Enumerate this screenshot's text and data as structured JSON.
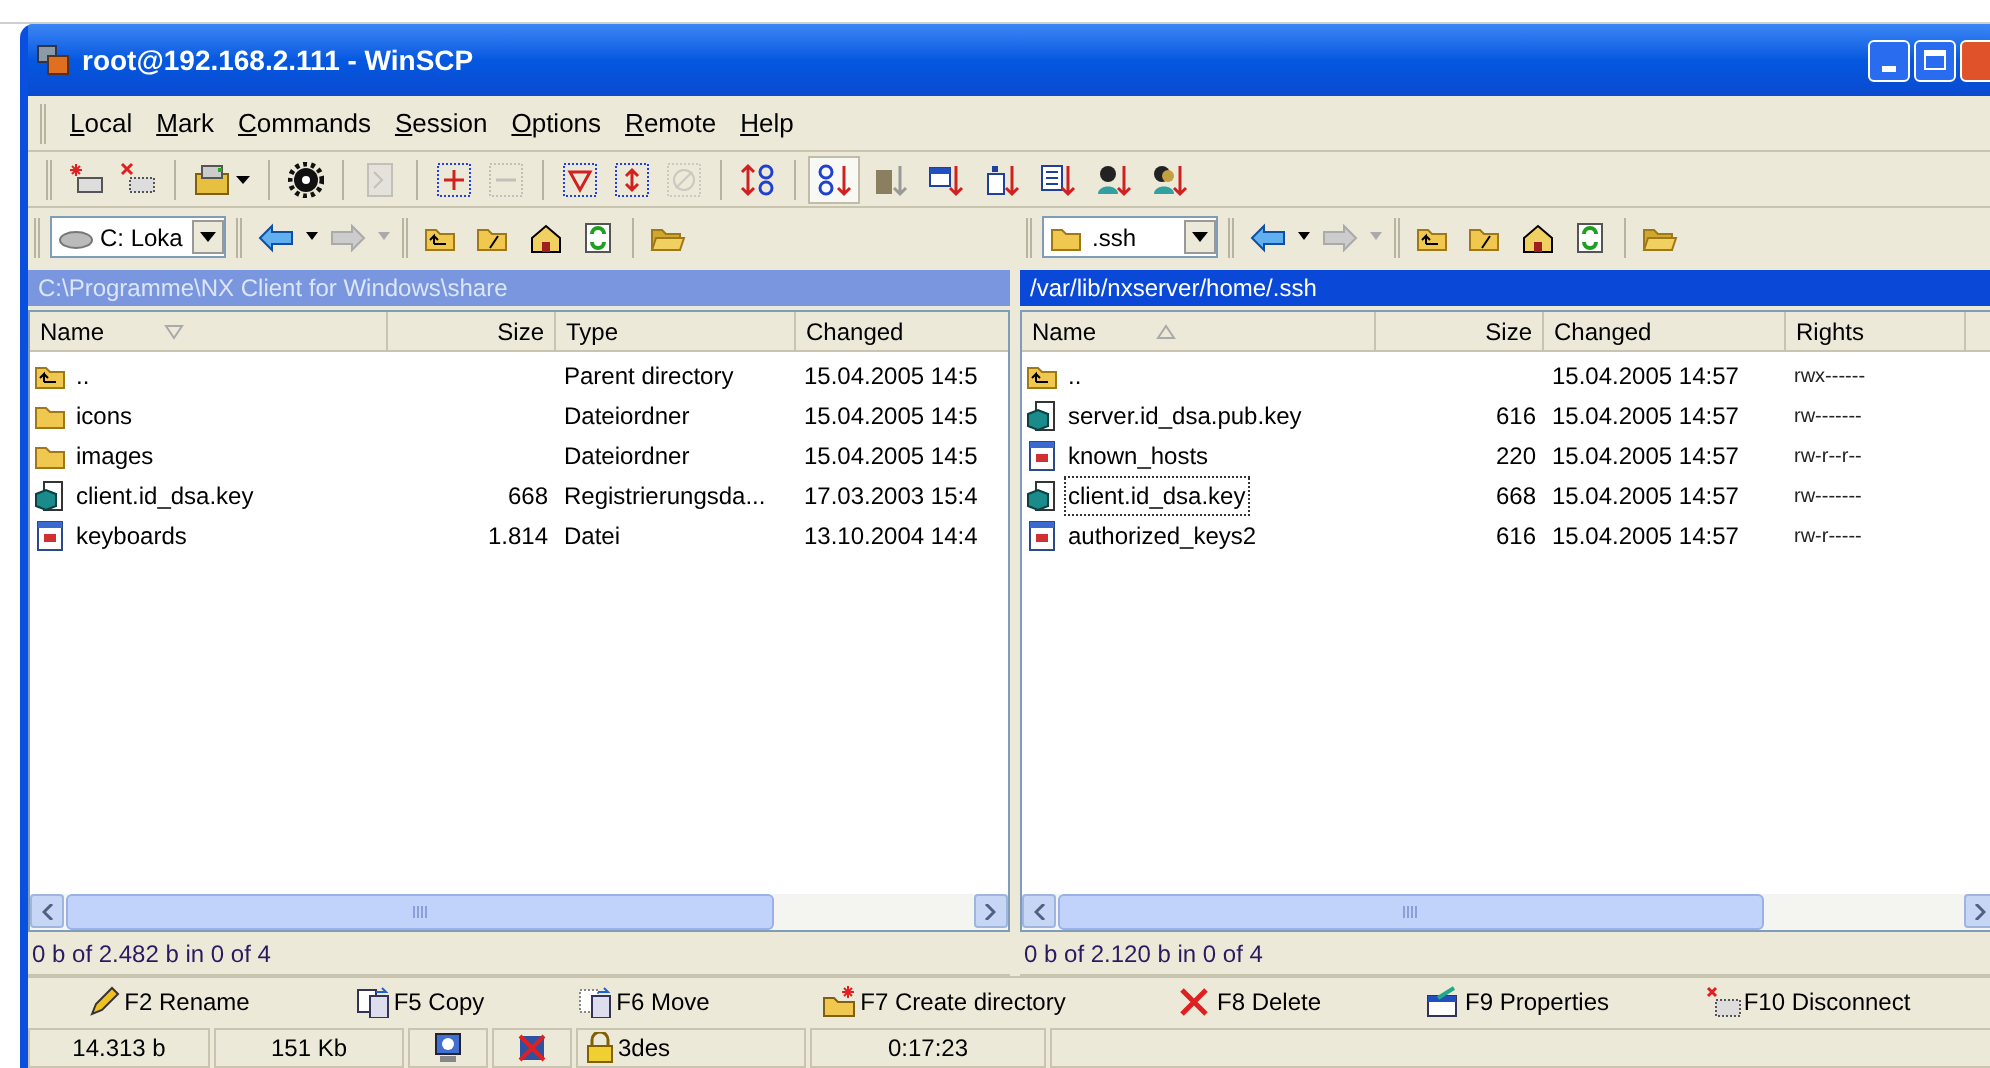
{
  "window": {
    "title": "root@192.168.2.111 - WinSCP"
  },
  "menu": [
    {
      "label": "Local"
    },
    {
      "label": "Mark"
    },
    {
      "label": "Commands"
    },
    {
      "label": "Session"
    },
    {
      "label": "Options"
    },
    {
      "label": "Remote"
    },
    {
      "label": "Help"
    }
  ],
  "toolbar": {
    "buttons": [
      {
        "kind": "new-session",
        "disabled": false
      },
      {
        "kind": "close-session",
        "disabled": false
      },
      {
        "kind": "separator"
      },
      {
        "kind": "save-session",
        "disabled": false
      },
      {
        "kind": "separator"
      },
      {
        "kind": "preferences",
        "disabled": false
      },
      {
        "kind": "separator"
      },
      {
        "kind": "terminal",
        "disabled": true
      },
      {
        "kind": "separator"
      },
      {
        "kind": "select",
        "disabled": false
      },
      {
        "kind": "unselect",
        "disabled": true
      },
      {
        "kind": "separator"
      },
      {
        "kind": "filter",
        "disabled": false
      },
      {
        "kind": "invert",
        "disabled": false
      },
      {
        "kind": "clear",
        "disabled": true
      },
      {
        "kind": "separator"
      },
      {
        "kind": "sort-toggle",
        "disabled": false
      },
      {
        "kind": "separator"
      }
    ],
    "sort_buttons": [
      {
        "kind": "name",
        "selected": true
      },
      {
        "kind": "ext",
        "selected": false
      },
      {
        "kind": "time",
        "selected": false
      },
      {
        "kind": "size",
        "selected": false
      },
      {
        "kind": "type",
        "selected": false
      },
      {
        "kind": "owner",
        "selected": false
      },
      {
        "kind": "group",
        "selected": false
      }
    ]
  },
  "panels": [
    {
      "kind": "local",
      "drive": "C: Loka",
      "path": "C:\\Programme\\NX Client for Windows\\share",
      "active": false,
      "columns": [
        {
          "label": "Name",
          "sorted": true,
          "ascending": false
        },
        {
          "label": "Size",
          "sorted": false
        },
        {
          "label": "Type",
          "sorted": false
        },
        {
          "label": "Changed",
          "sorted": false
        }
      ],
      "rows": [
        {
          "kind": "parent",
          "cells": [
            "..",
            "",
            "Parent directory",
            "15.04.2005 14:5"
          ],
          "focused": false
        },
        {
          "kind": "folder",
          "cells": [
            "icons",
            "",
            "Dateiordner",
            "15.04.2005 14:5"
          ],
          "focused": false
        },
        {
          "kind": "folder",
          "cells": [
            "images",
            "",
            "Dateiordner",
            "15.04.2005 14:5"
          ],
          "focused": false
        },
        {
          "kind": "key",
          "cells": [
            "client.id_dsa.key",
            "668",
            "Registrierungsda...",
            "17.03.2003 15:4"
          ],
          "focused": false
        },
        {
          "kind": "file",
          "cells": [
            "keyboards",
            "1.814",
            "Datei",
            "13.10.2004 14:4"
          ],
          "focused": false
        }
      ],
      "status": "0 b of 2.482 b in 0 of 4"
    },
    {
      "kind": "remote",
      "drive": ".ssh",
      "path": "/var/lib/nxserver/home/.ssh",
      "active": true,
      "columns": [
        {
          "label": "Name",
          "sorted": true,
          "ascending": true
        },
        {
          "label": "Size",
          "sorted": false
        },
        {
          "label": "Changed",
          "sorted": false
        },
        {
          "label": "Rights",
          "sorted": false
        }
      ],
      "rows": [
        {
          "kind": "parent",
          "cells": [
            "..",
            "",
            "15.04.2005 14:57",
            "rwx------"
          ],
          "focused": false
        },
        {
          "kind": "key",
          "cells": [
            "server.id_dsa.pub.key",
            "616",
            "15.04.2005 14:57",
            "rw-------"
          ],
          "focused": false
        },
        {
          "kind": "file",
          "cells": [
            "known_hosts",
            "220",
            "15.04.2005 14:57",
            "rw-r--r--"
          ],
          "focused": false
        },
        {
          "kind": "key",
          "cells": [
            "client.id_dsa.key",
            "668",
            "15.04.2005 14:57",
            "rw-------"
          ],
          "focused": true
        },
        {
          "kind": "file",
          "cells": [
            "authorized_keys2",
            "616",
            "15.04.2005 14:57",
            "rw-r-----"
          ],
          "focused": false
        }
      ],
      "status": "0 b of 2.120 b in 0 of 4"
    }
  ],
  "commands": [
    {
      "kind": "rename",
      "label": "F2 Rename"
    },
    {
      "kind": "copy",
      "label": "F5 Copy"
    },
    {
      "kind": "move",
      "label": "F6 Move"
    },
    {
      "kind": "mkdir",
      "label": "F7 Create directory"
    },
    {
      "kind": "delete",
      "label": "F8 Delete"
    },
    {
      "kind": "properties",
      "label": "F9 Properties"
    },
    {
      "kind": "disconnect",
      "label": "F10 Disconnect"
    }
  ],
  "status_bar": [
    {
      "kind": "text",
      "text": "14.313 b"
    },
    {
      "kind": "text",
      "text": "151 Kb"
    },
    {
      "kind": "protocol-icon"
    },
    {
      "kind": "queue-icon"
    },
    {
      "kind": "lock",
      "text": "3des"
    },
    {
      "kind": "text",
      "text": "0:17:23"
    },
    {
      "kind": "empty"
    }
  ]
}
